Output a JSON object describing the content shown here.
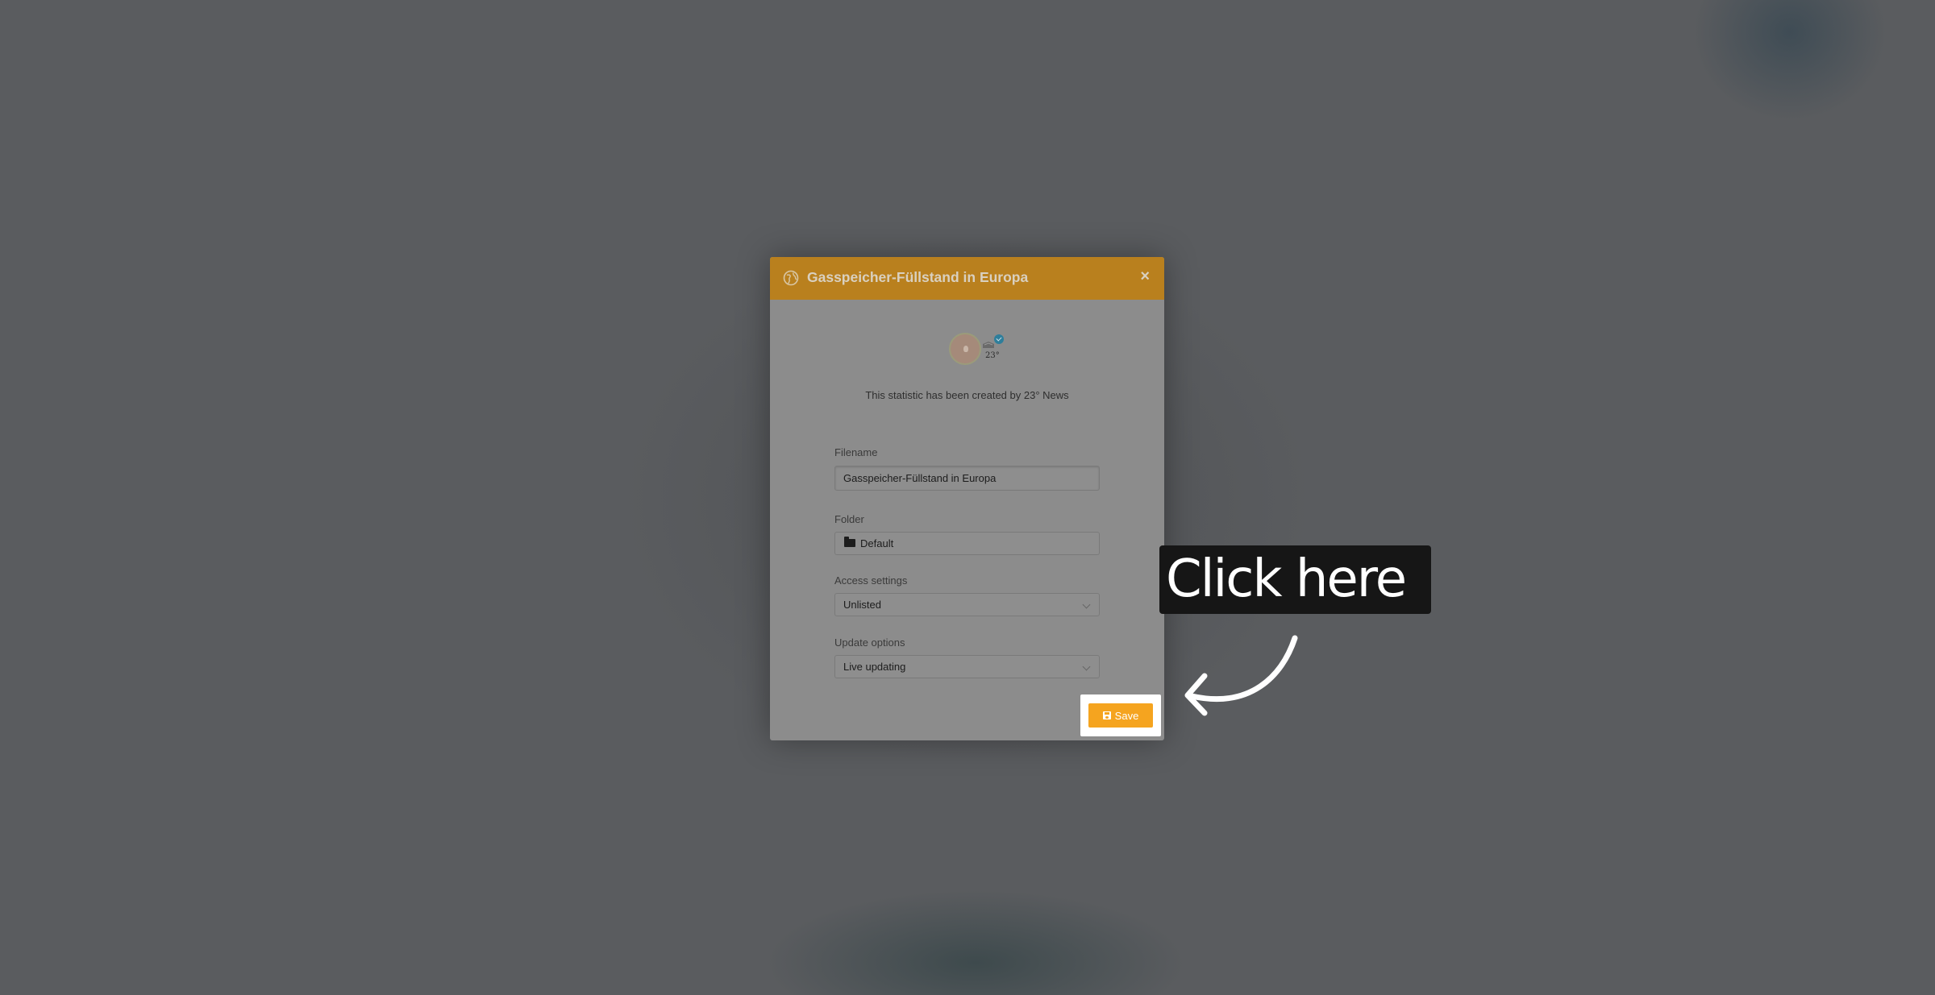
{
  "modal": {
    "title": "Gasspeicher-Füllstand in Europa",
    "close_label": "×",
    "creator_text": "This statistic has been created by 23° News",
    "logo_text": "23°"
  },
  "form": {
    "filename": {
      "label": "Filename",
      "value": "Gasspeicher-Füllstand in Europa"
    },
    "folder": {
      "label": "Folder",
      "value": "Default"
    },
    "access": {
      "label": "Access settings",
      "value": "Unlisted"
    },
    "update": {
      "label": "Update options",
      "value": "Live updating"
    },
    "save_label": "Save"
  },
  "callout": {
    "text": "Click here"
  },
  "colors": {
    "header": "#b9801e",
    "save_button": "#f5a41f",
    "callout_bg": "#161616"
  }
}
